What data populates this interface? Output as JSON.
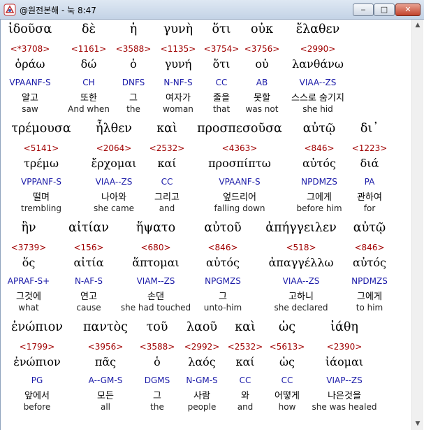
{
  "window": {
    "title": "@원전본해 - 눅 8:47",
    "minimize": "‒",
    "maximize": "□",
    "close": "✕"
  },
  "scrollbar": {
    "up": "▲",
    "down": "▼"
  },
  "blocks": [
    {
      "words": [
        {
          "gr": "ἰδοῦσα",
          "st": "<*3708>",
          "lx": "ὁράω",
          "ps": "VPAANF-S",
          "ko": "알고",
          "en": "saw"
        },
        {
          "gr": "δὲ",
          "st": "<1161>",
          "lx": "δώ",
          "ps": "CH",
          "ko": "또한",
          "en": "And when"
        },
        {
          "gr": "ἡ",
          "st": "<3588>",
          "lx": "ὁ",
          "ps": "DNFS",
          "ko": "그",
          "en": "the"
        },
        {
          "gr": "γυνὴ",
          "st": "<1135>",
          "lx": "γυνή",
          "ps": "N-NF-S",
          "ko": "여자가",
          "en": "woman"
        },
        {
          "gr": "ὅτι",
          "st": "<3754>",
          "lx": "ὅτι",
          "ps": "CC",
          "ko": "줄을",
          "en": "that"
        },
        {
          "gr": "οὐκ",
          "st": "<3756>",
          "lx": "οὐ",
          "ps": "AB",
          "ko": "못할",
          "en": "was not"
        },
        {
          "gr": "ἔλαθεν",
          "st": "<2990>",
          "lx": "λανθάνω",
          "ps": "VIAA--ZS",
          "ko": "스스로 숨기지",
          "en": "she hid"
        }
      ]
    },
    {
      "words": [
        {
          "gr": "τρέμουσα",
          "st": "<5141>",
          "lx": "τρέμω",
          "ps": "VPPANF-S",
          "ko": "떨며",
          "en": "trembling"
        },
        {
          "gr": "ἦλθεν",
          "st": "<2064>",
          "lx": "ἔρχομαι",
          "ps": "VIAA--ZS",
          "ko": "나아와",
          "en": "she came"
        },
        {
          "gr": "καὶ",
          "st": "<2532>",
          "lx": "καί",
          "ps": "CC",
          "ko": "그리고",
          "en": "and"
        },
        {
          "gr": "προσπεσοῦσα",
          "st": "<4363>",
          "lx": "προσπίπτω",
          "ps": "VPAANF-S",
          "ko": "엎드리어",
          "en": "falling down"
        },
        {
          "gr": "αὐτῷ",
          "st": "<846>",
          "lx": "αὐτός",
          "ps": "NPDMZS",
          "ko": "그에게",
          "en": "before him"
        },
        {
          "gr": "δι᾽",
          "st": "<1223>",
          "lx": "διά",
          "ps": "PA",
          "ko": "관하여",
          "en": "for"
        }
      ]
    },
    {
      "words": [
        {
          "gr": "ἣν",
          "st": "<3739>",
          "lx": "ὅς",
          "ps": "APRAF-S+",
          "ko": "그것에",
          "en": "what"
        },
        {
          "gr": "αἰτίαν",
          "st": "<156>",
          "lx": "αἰτία",
          "ps": "N-AF-S",
          "ko": "연고",
          "en": "cause"
        },
        {
          "gr": "ἥψατο",
          "st": "<680>",
          "lx": "ἅπτομαι",
          "ps": "VIAM--ZS",
          "ko": "손댄",
          "en": "she had touched"
        },
        {
          "gr": "αὐτοῦ",
          "st": "<846>",
          "lx": "αὐτός",
          "ps": "NPGMZS",
          "ko": "그",
          "en": "unto-him"
        },
        {
          "gr": "ἀπήγγειλεν",
          "st": "<518>",
          "lx": "ἀπαγγέλλω",
          "ps": "VIAA--ZS",
          "ko": "고하니",
          "en": "she declared"
        },
        {
          "gr": "αὐτῷ",
          "st": "<846>",
          "lx": "αὐτός",
          "ps": "NPDMZS",
          "ko": "그에게",
          "en": "to him"
        }
      ]
    },
    {
      "words": [
        {
          "gr": "ἐνώπιον",
          "st": "<1799>",
          "lx": "ἐνώπιον",
          "ps": "PG",
          "ko": "앞에서",
          "en": "before"
        },
        {
          "gr": "παντὸς",
          "st": "<3956>",
          "lx": "πᾶς",
          "ps": "A--GM-S",
          "ko": "모든",
          "en": "all"
        },
        {
          "gr": "τοῦ",
          "st": "<3588>",
          "lx": "ὁ",
          "ps": "DGMS",
          "ko": "그",
          "en": "the"
        },
        {
          "gr": "λαοῦ",
          "st": "<2992>",
          "lx": "λαός",
          "ps": "N-GM-S",
          "ko": "사람",
          "en": "people"
        },
        {
          "gr": "καὶ",
          "st": "<2532>",
          "lx": "καί",
          "ps": "CC",
          "ko": "와",
          "en": "and"
        },
        {
          "gr": "ὡς",
          "st": "<5613>",
          "lx": "ὡς",
          "ps": "CC",
          "ko": "어떻게",
          "en": "how"
        },
        {
          "gr": "ἰάθη",
          "st": "<2390>",
          "lx": "ἰάομαι",
          "ps": "VIAP--ZS",
          "ko": "나은것을",
          "en": "she was healed"
        }
      ]
    }
  ]
}
